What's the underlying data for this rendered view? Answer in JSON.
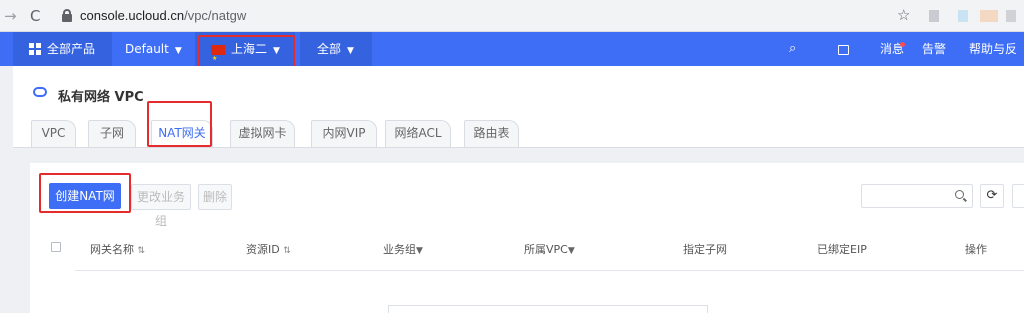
{
  "browser": {
    "url_host": "console.ucloud.cn",
    "url_path": "/vpc/natgw"
  },
  "topnav": {
    "all_products": "全部产品",
    "project": "Default",
    "region": "上海二",
    "scope": "全部",
    "messages": "消息",
    "alerts": "告警",
    "help": "帮助与反馈"
  },
  "page": {
    "title": "私有网络 VPC"
  },
  "tabs": [
    {
      "label": "VPC"
    },
    {
      "label": "子网"
    },
    {
      "label": "NAT网关"
    },
    {
      "label": "虚拟网卡"
    },
    {
      "label": "内网VIP"
    },
    {
      "label": "网络ACL"
    },
    {
      "label": "路由表"
    }
  ],
  "toolbar": {
    "create_label": "创建NAT网关",
    "change_group_label": "更改业务组",
    "delete_label": "删除"
  },
  "table": {
    "columns": [
      "网关名称",
      "资源ID",
      "业务组",
      "所属VPC",
      "指定子网",
      "已绑定EIP",
      "操作"
    ]
  },
  "colors": {
    "primary": "#3d6ef5",
    "highlight_box": "#e52c2c"
  }
}
